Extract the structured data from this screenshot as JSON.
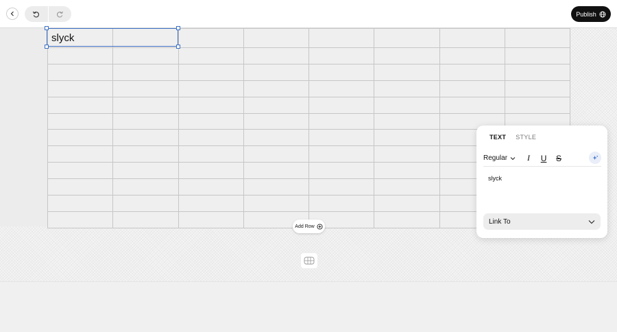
{
  "topbar": {
    "back_icon": "chevron-left-icon",
    "undo_icon": "undo-icon",
    "redo_icon": "redo-icon",
    "publish_label": "Publish",
    "publish_icon": "globe-icon"
  },
  "table": {
    "columns": 8,
    "rows": 12,
    "cells": [
      [
        "slyck",
        "",
        "",
        "",
        "",
        "",
        "",
        ""
      ]
    ],
    "selected_cell_text": "slyck"
  },
  "canvas": {
    "add_row_label": "Add Row",
    "add_row_icon": "plus-circle-icon",
    "table_icon": "table-icon"
  },
  "panel": {
    "tabs": [
      "TEXT",
      "STYLE"
    ],
    "active_tab": "TEXT",
    "font_weight": "Regular",
    "format_buttons": [
      "I",
      "U",
      "S"
    ],
    "ai_icon": "sparkle-icon",
    "text_value": "slyck",
    "link_label": "Link To"
  },
  "colors": {
    "selection": "#3b6fc4",
    "publish_bg": "#111111",
    "grid_line": "#c6c6c6"
  }
}
